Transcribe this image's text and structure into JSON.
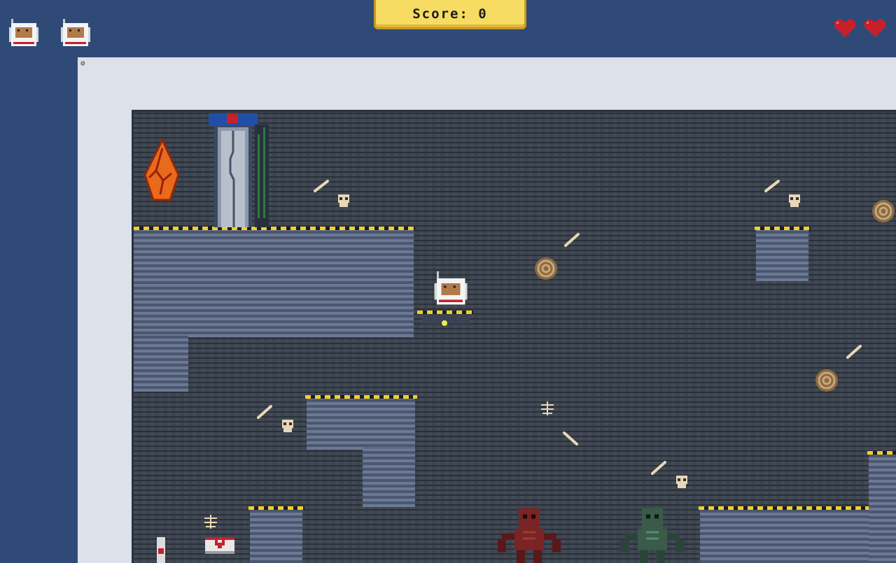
{
  "hud": {
    "score_label": "Score: 0",
    "lives_remaining": 2,
    "hearts": 2
  },
  "colors": {
    "background": "#2f4a77",
    "score_fill": "#f6dc62",
    "heart": "#c8202a",
    "hazard_stripe": "#f2cf2a"
  },
  "icons": {
    "life": "astronaut-head-icon",
    "heart": "heart-icon",
    "frame_corner": "circle-slash-icon",
    "exit": "exit-door-icon",
    "crystal": "fire-crystal-icon",
    "health": "health-chest-icon"
  }
}
